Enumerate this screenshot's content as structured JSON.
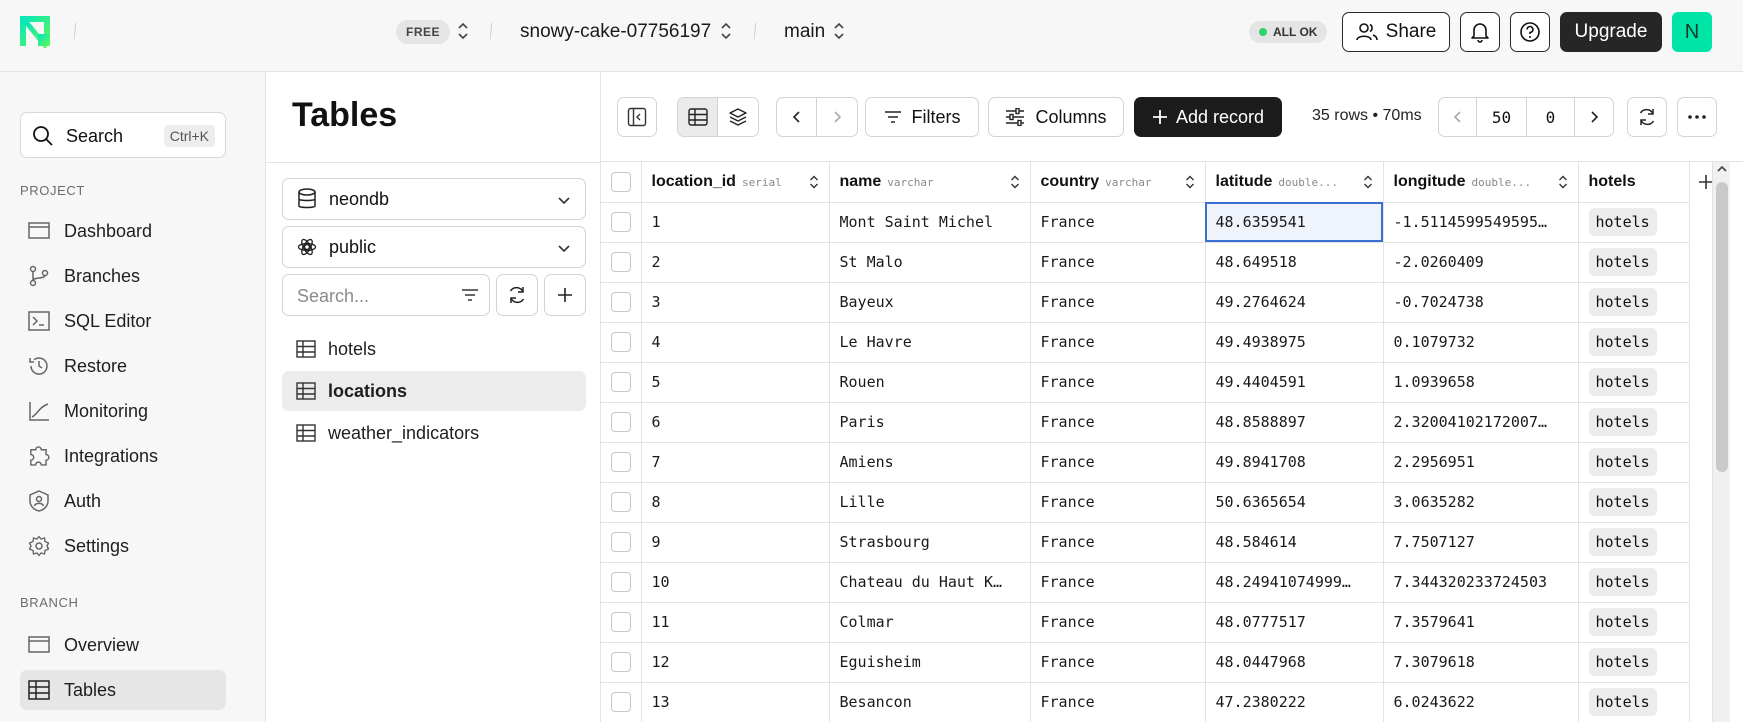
{
  "topbar": {
    "plan": "FREE",
    "project": "snowy-cake-07756197",
    "branch": "main",
    "status": "ALL OK",
    "share_label": "Share",
    "upgrade_label": "Upgrade",
    "avatar_initial": "N",
    "accent_color": "#00e4a5"
  },
  "sidebar": {
    "search_label": "Search",
    "search_shortcut": "Ctrl+K",
    "project_section": "PROJECT",
    "project_items": [
      {
        "label": "Dashboard",
        "icon": "dashboard-icon"
      },
      {
        "label": "Branches",
        "icon": "branch-icon"
      },
      {
        "label": "SQL Editor",
        "icon": "sql-editor-icon"
      },
      {
        "label": "Restore",
        "icon": "restore-icon"
      },
      {
        "label": "Monitoring",
        "icon": "monitoring-icon"
      },
      {
        "label": "Integrations",
        "icon": "integrations-icon"
      },
      {
        "label": "Auth",
        "icon": "auth-icon"
      },
      {
        "label": "Settings",
        "icon": "settings-icon"
      }
    ],
    "branch_section": "BRANCH",
    "branch_items": [
      {
        "label": "Overview",
        "icon": "overview-icon"
      },
      {
        "label": "Tables",
        "icon": "tables-icon",
        "active": true
      }
    ]
  },
  "tables_panel": {
    "title": "Tables",
    "database": "neondb",
    "schema": "public",
    "search_placeholder": "Search...",
    "tables": [
      {
        "name": "hotels"
      },
      {
        "name": "locations",
        "active": true
      },
      {
        "name": "weather_indicators"
      }
    ]
  },
  "toolbar": {
    "filters_label": "Filters",
    "columns_label": "Columns",
    "add_record_label": "Add record",
    "rows_info": "35 rows • 70ms",
    "page_size": "50",
    "offset": "0"
  },
  "grid": {
    "columns": [
      {
        "name": "location_id",
        "type": "serial"
      },
      {
        "name": "name",
        "type": "varchar"
      },
      {
        "name": "country",
        "type": "varchar"
      },
      {
        "name": "latitude",
        "type": "double..."
      },
      {
        "name": "longitude",
        "type": "double..."
      },
      {
        "name": "hotels",
        "type": ""
      }
    ],
    "rows": [
      {
        "id": "1",
        "name": "Mont Saint Michel",
        "country": "France",
        "lat": "48.6359541",
        "lon": "-1.5114599549595…",
        "hotels": "hotels"
      },
      {
        "id": "2",
        "name": "St Malo",
        "country": "France",
        "lat": "48.649518",
        "lon": "-2.0260409",
        "hotels": "hotels"
      },
      {
        "id": "3",
        "name": "Bayeux",
        "country": "France",
        "lat": "49.2764624",
        "lon": "-0.7024738",
        "hotels": "hotels"
      },
      {
        "id": "4",
        "name": "Le Havre",
        "country": "France",
        "lat": "49.4938975",
        "lon": "0.1079732",
        "hotels": "hotels"
      },
      {
        "id": "5",
        "name": "Rouen",
        "country": "France",
        "lat": "49.4404591",
        "lon": "1.0939658",
        "hotels": "hotels"
      },
      {
        "id": "6",
        "name": "Paris",
        "country": "France",
        "lat": "48.8588897",
        "lon": "2.32004102172007…",
        "hotels": "hotels"
      },
      {
        "id": "7",
        "name": "Amiens",
        "country": "France",
        "lat": "49.8941708",
        "lon": "2.2956951",
        "hotels": "hotels"
      },
      {
        "id": "8",
        "name": "Lille",
        "country": "France",
        "lat": "50.6365654",
        "lon": "3.0635282",
        "hotels": "hotels"
      },
      {
        "id": "9",
        "name": "Strasbourg",
        "country": "France",
        "lat": "48.584614",
        "lon": "7.7507127",
        "hotels": "hotels"
      },
      {
        "id": "10",
        "name": "Chateau du Haut K…",
        "country": "France",
        "lat": "48.24941074999…",
        "lon": "7.344320233724503",
        "hotels": "hotels"
      },
      {
        "id": "11",
        "name": "Colmar",
        "country": "France",
        "lat": "48.0777517",
        "lon": "7.3579641",
        "hotels": "hotels"
      },
      {
        "id": "12",
        "name": "Eguisheim",
        "country": "France",
        "lat": "48.0447968",
        "lon": "7.3079618",
        "hotels": "hotels"
      },
      {
        "id": "13",
        "name": "Besancon",
        "country": "France",
        "lat": "47.2380222",
        "lon": "6.0243622",
        "hotels": "hotels"
      }
    ]
  }
}
